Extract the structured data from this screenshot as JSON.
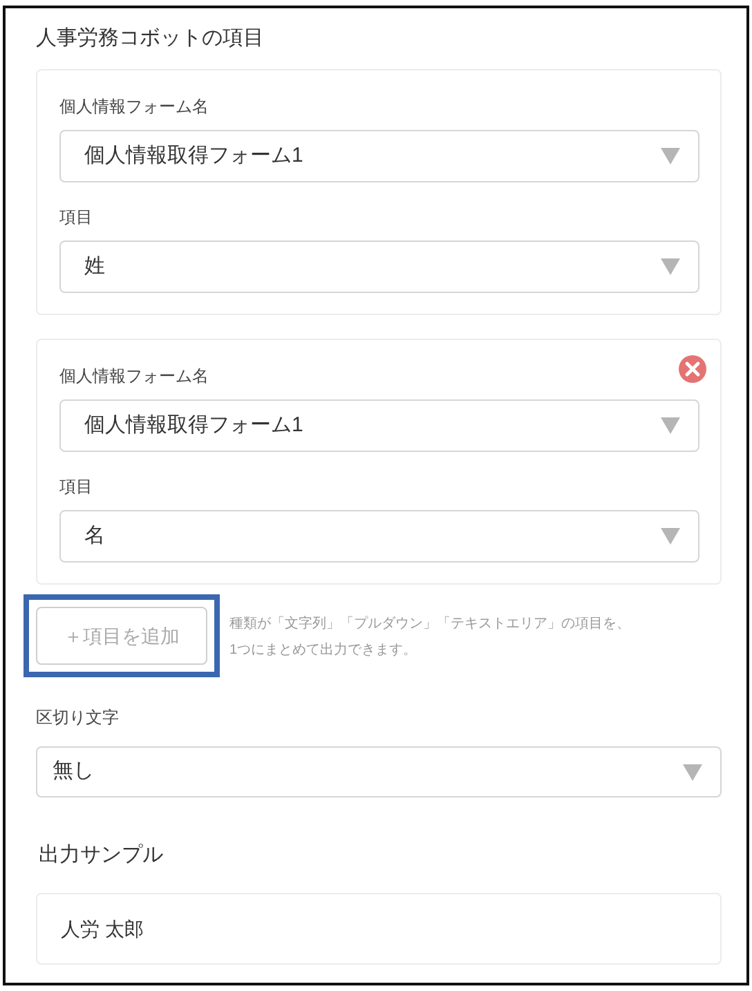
{
  "section_title": "人事労務コボットの項目",
  "item_groups": [
    {
      "removable": false,
      "fields": [
        {
          "label": "個人情報フォーム名",
          "value": "個人情報取得フォーム1"
        },
        {
          "label": "項目",
          "value": "姓"
        }
      ]
    },
    {
      "removable": true,
      "fields": [
        {
          "label": "個人情報フォーム名",
          "value": "個人情報取得フォーム1"
        },
        {
          "label": "項目",
          "value": "名"
        }
      ]
    }
  ],
  "add_button": {
    "label": "＋項目を追加",
    "highlighted": true
  },
  "hint_lines": [
    "種類が「文字列」「プルダウン」「テキストエリア」の項目を、",
    "1つにまとめて出力できます。"
  ],
  "separator": {
    "label": "区切り文字",
    "value": "無し"
  },
  "sample": {
    "title": "出力サンプル",
    "value": "人労 太郎"
  }
}
